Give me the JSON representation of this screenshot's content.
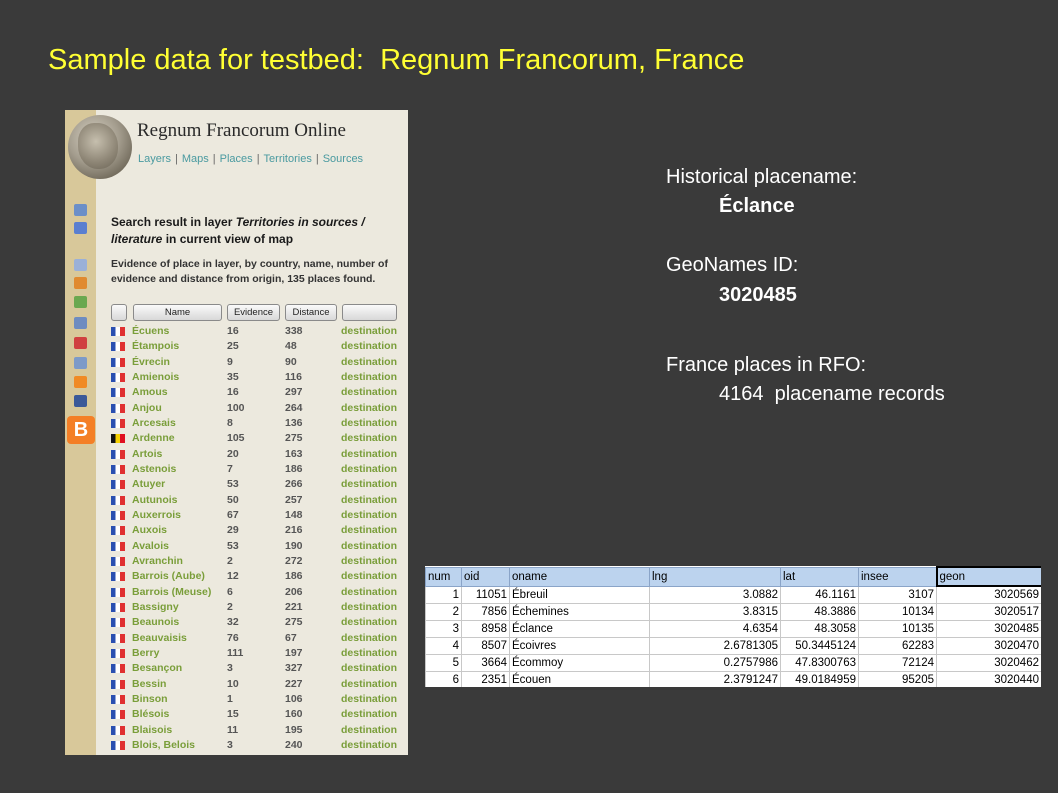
{
  "slide_title": "Sample data for testbed:  Regnum Francorum, France",
  "rfo": {
    "title": "Regnum Francorum Online",
    "nav": [
      "Layers",
      "Maps",
      "Places",
      "Territories",
      "Sources"
    ],
    "search_title_prefix": "Search result in layer ",
    "search_title_italic": "Territories in sources / literature",
    "search_title_suffix": " in current view of map",
    "evidence_text": "Evidence of place in layer, by country, name, number of evidence and distance from origin, 135 places found.",
    "buttons": {
      "name": "Name",
      "evidence": "Evidence",
      "distance": "Distance"
    },
    "blogger_letter": "B",
    "side_icons": [
      "map-icon",
      "zoom-icon",
      "layers-icon",
      "tools-icon",
      "puzzle-icon",
      "list-icon",
      "calendar-icon",
      "search-icon",
      "rss-icon",
      "facebook-icon"
    ],
    "rows": [
      {
        "name": "Écuens",
        "evidence": "16",
        "distance": "338",
        "link": "destination",
        "flag": "fr"
      },
      {
        "name": "Étampois",
        "evidence": "25",
        "distance": "48",
        "link": "destination",
        "flag": "fr"
      },
      {
        "name": "Évrecin",
        "evidence": "9",
        "distance": "90",
        "link": "destination",
        "flag": "fr"
      },
      {
        "name": "Amienois",
        "evidence": "35",
        "distance": "116",
        "link": "destination",
        "flag": "fr"
      },
      {
        "name": "Amous",
        "evidence": "16",
        "distance": "297",
        "link": "destination",
        "flag": "fr"
      },
      {
        "name": "Anjou",
        "evidence": "100",
        "distance": "264",
        "link": "destination",
        "flag": "fr"
      },
      {
        "name": "Arcesais",
        "evidence": "8",
        "distance": "136",
        "link": "destination",
        "flag": "fr"
      },
      {
        "name": "Ardenne",
        "evidence": "105",
        "distance": "275",
        "link": "destination",
        "flag": "be"
      },
      {
        "name": "Artois",
        "evidence": "20",
        "distance": "163",
        "link": "destination",
        "flag": "fr"
      },
      {
        "name": "Astenois",
        "evidence": "7",
        "distance": "186",
        "link": "destination",
        "flag": "fr"
      },
      {
        "name": "Atuyer",
        "evidence": "53",
        "distance": "266",
        "link": "destination",
        "flag": "fr"
      },
      {
        "name": "Autunois",
        "evidence": "50",
        "distance": "257",
        "link": "destination",
        "flag": "fr"
      },
      {
        "name": "Auxerrois",
        "evidence": "67",
        "distance": "148",
        "link": "destination",
        "flag": "fr"
      },
      {
        "name": "Auxois",
        "evidence": "29",
        "distance": "216",
        "link": "destination",
        "flag": "fr"
      },
      {
        "name": "Avalois",
        "evidence": "53",
        "distance": "190",
        "link": "destination",
        "flag": "fr"
      },
      {
        "name": "Avranchin",
        "evidence": "2",
        "distance": "272",
        "link": "destination",
        "flag": "fr"
      },
      {
        "name": "Barrois (Aube)",
        "evidence": "12",
        "distance": "186",
        "link": "destination",
        "flag": "fr"
      },
      {
        "name": "Barrois (Meuse)",
        "evidence": "6",
        "distance": "206",
        "link": "destination",
        "flag": "fr"
      },
      {
        "name": "Bassigny",
        "evidence": "2",
        "distance": "221",
        "link": "destination",
        "flag": "fr"
      },
      {
        "name": "Beaunois",
        "evidence": "32",
        "distance": "275",
        "link": "destination",
        "flag": "fr"
      },
      {
        "name": "Beauvaisis",
        "evidence": "76",
        "distance": "67",
        "link": "destination",
        "flag": "fr"
      },
      {
        "name": "Berry",
        "evidence": "111",
        "distance": "197",
        "link": "destination",
        "flag": "fr"
      },
      {
        "name": "Besançon",
        "evidence": "3",
        "distance": "327",
        "link": "destination",
        "flag": "fr"
      },
      {
        "name": "Bessin",
        "evidence": "10",
        "distance": "227",
        "link": "destination",
        "flag": "fr"
      },
      {
        "name": "Binson",
        "evidence": "1",
        "distance": "106",
        "link": "destination",
        "flag": "fr"
      },
      {
        "name": "Blésois",
        "evidence": "15",
        "distance": "160",
        "link": "destination",
        "flag": "fr"
      },
      {
        "name": "Blaisois",
        "evidence": "11",
        "distance": "195",
        "link": "destination",
        "flag": "fr"
      },
      {
        "name": "Blois, Belois",
        "evidence": "3",
        "distance": "240",
        "link": "destination",
        "flag": "fr"
      }
    ],
    "colors": {
      "link_green": "#7a9e3a",
      "nav_teal": "#4a9aa0",
      "sidebar": "#d8c89a",
      "panel": "#ece9de"
    }
  },
  "info": {
    "label1": "Historical placename:",
    "value1": "Éclance",
    "label2": "GeoNames ID:",
    "value2": "3020485",
    "label3": "France places in RFO:",
    "value3": "4164  placename records"
  },
  "sheet": {
    "headers": [
      "num",
      "oid",
      "oname",
      "lng",
      "lat",
      "insee",
      "geon"
    ],
    "rows": [
      [
        "1",
        "11051",
        "Ébreuil",
        "3.0882",
        "46.1161",
        "3107",
        "3020569"
      ],
      [
        "2",
        "7856",
        "Échemines",
        "3.8315",
        "48.3886",
        "10134",
        "3020517"
      ],
      [
        "3",
        "8958",
        "Éclance",
        "4.6354",
        "48.3058",
        "10135",
        "3020485"
      ],
      [
        "4",
        "8507",
        "Écoivres",
        "2.6781305",
        "50.3445124",
        "62283",
        "3020470"
      ],
      [
        "5",
        "3664",
        "Écommoy",
        "0.2757986",
        "47.8300763",
        "72124",
        "3020462"
      ],
      [
        "6",
        "2351",
        "Écouen",
        "2.3791247",
        "49.0184959",
        "95205",
        "3020440"
      ]
    ]
  },
  "colors": {
    "background": "#3a3a3a",
    "title_yellow": "#ffff33",
    "header_blue": "#bcd3ee"
  }
}
